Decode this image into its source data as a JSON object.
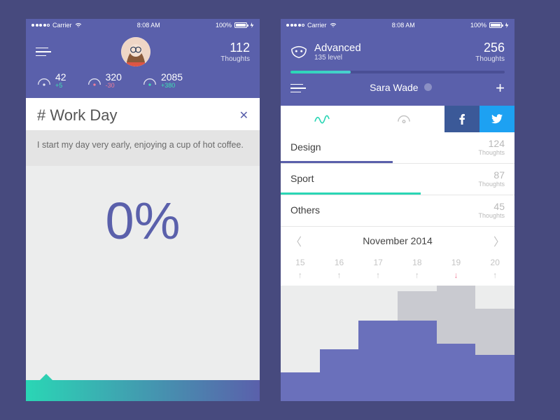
{
  "statusbar": {
    "carrier": "Carrier",
    "time": "8:08 AM",
    "battery": "100%"
  },
  "left": {
    "thoughts": {
      "count": "112",
      "label": "Thoughts"
    },
    "stats": [
      {
        "value": "42",
        "delta": "+5",
        "delta_class": "d-plus"
      },
      {
        "value": "320",
        "delta": "-30",
        "delta_class": "d-minus"
      },
      {
        "value": "2085",
        "delta": "+380",
        "delta_class": "d-plus"
      }
    ],
    "card": {
      "title": "# Work Day",
      "body": "I start my day very early, enjoying a cup of hot coffee."
    },
    "progress_pct": "0%"
  },
  "right": {
    "thoughts": {
      "count": "256",
      "label": "Thoughts"
    },
    "level": {
      "title": "Advanced",
      "sub": "135 level",
      "progress_pct": 28
    },
    "user_name": "Sara Wade",
    "categories": [
      {
        "name": "Design",
        "count": "124",
        "label": "Thoughts",
        "color": "#5a60ab",
        "bar_pct": 48
      },
      {
        "name": "Sport",
        "count": "87",
        "label": "Thoughts",
        "color": "#2ad6b5",
        "bar_pct": 60
      },
      {
        "name": "Others",
        "count": "45",
        "label": "Thoughts",
        "color": "transparent",
        "bar_pct": 0
      }
    ],
    "month_label": "November 2014",
    "days": [
      {
        "d": "15",
        "dir": "up"
      },
      {
        "d": "16",
        "dir": "up"
      },
      {
        "d": "17",
        "dir": "up"
      },
      {
        "d": "18",
        "dir": "up"
      },
      {
        "d": "19",
        "dir": "down"
      },
      {
        "d": "20",
        "dir": "up"
      }
    ]
  },
  "chart_data": {
    "type": "bar",
    "note": "Stacked step-like bars; values are estimated relative heights (0-100) per visible column. 'purple' is the primary series, 'grey' sits on top in some columns.",
    "categories": [
      "15",
      "16",
      "17",
      "18",
      "19",
      "20"
    ],
    "series": [
      {
        "name": "purple",
        "values": [
          25,
          45,
          70,
          70,
          50,
          40
        ]
      },
      {
        "name": "grey",
        "values": [
          0,
          0,
          0,
          25,
          50,
          40
        ]
      }
    ],
    "ylim": [
      0,
      100
    ]
  }
}
